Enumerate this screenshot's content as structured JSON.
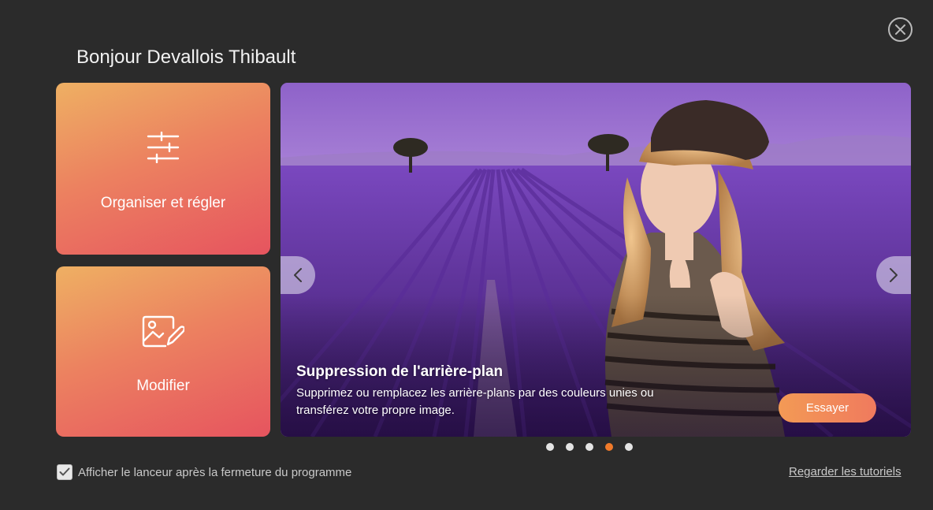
{
  "header": {
    "greeting": "Bonjour Devallois Thibault",
    "close_icon": "close-circle-icon"
  },
  "tiles": [
    {
      "label": "Organiser et régler",
      "icon": "sliders-icon"
    },
    {
      "label": "Modifier",
      "icon": "image-edit-icon"
    }
  ],
  "carousel": {
    "slide_title": "Suppression de l'arrière-plan",
    "slide_description": "Supprimez ou remplacez les arrière-plans par des couleurs unies ou transférez votre propre image.",
    "action_label": "Essayer",
    "prev_icon": "chevron-left-icon",
    "next_icon": "chevron-right-icon",
    "slide_count": 5,
    "active_index": 3
  },
  "footer": {
    "checkbox_label": "Afficher le lanceur après la fermeture du programme",
    "checkbox_checked": true,
    "tutorials_link": "Regarder les tutoriels"
  },
  "colors": {
    "background": "#2b2b2b",
    "tile_gradient_start": "#eeb063",
    "tile_gradient_end": "#e6545f",
    "accent_orange": "#f07a2a"
  }
}
